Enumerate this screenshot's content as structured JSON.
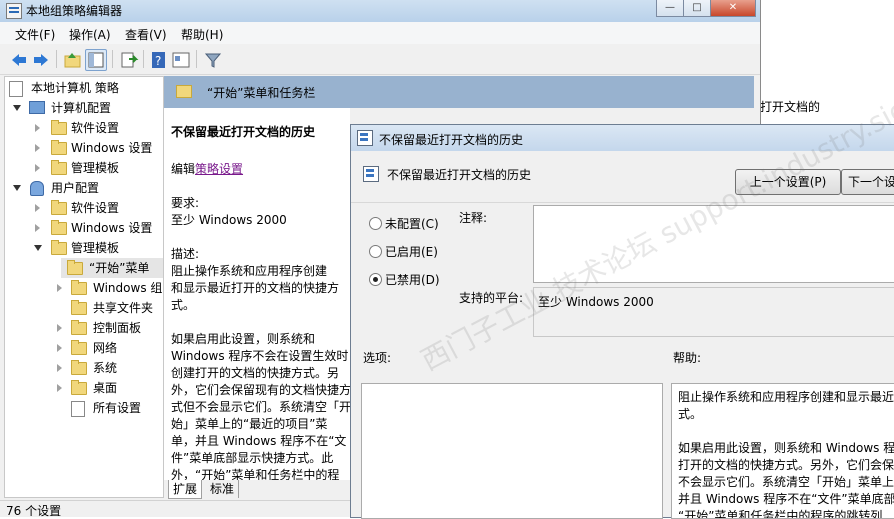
{
  "app": {
    "title": "本地组策略编辑器"
  },
  "caption_buttons": {
    "minimize": "—",
    "maximize": "□",
    "close": "✕"
  },
  "menu": [
    {
      "label": "文件(F)"
    },
    {
      "label": "操作(A)"
    },
    {
      "label": "查看(V)"
    },
    {
      "label": "帮助(H)"
    }
  ],
  "toolbar": {
    "icons": [
      "back-icon",
      "forward-icon",
      "up-folder-icon",
      "show-hide-tree-icon",
      "export-list-icon",
      "help-icon",
      "properties-icon",
      "filter-icon"
    ]
  },
  "tree": {
    "root": "本地计算机 策略",
    "computer_config": "计算机配置",
    "cc_software": "软件设置",
    "cc_windows": "Windows 设置",
    "cc_admin": "管理模板",
    "user_config": "用户配置",
    "uc_software": "软件设置",
    "uc_windows": "Windows 设置",
    "uc_admin": "管理模板",
    "start_menu": "“开始”菜单",
    "windows_components": "Windows 组",
    "shared_folders": "共享文件夹",
    "control_panel": "控制面板",
    "network": "网络",
    "system": "系统",
    "desktop": "桌面",
    "all_settings": "所有设置"
  },
  "right_pane": {
    "header_title": "“开始”菜单和任务栏",
    "policy_title": "不保留最近打开文档的历史",
    "edit_prefix": "编辑",
    "edit_link": "策略设置",
    "requirements_label": "要求:",
    "requirements_value": "至少 Windows 2000",
    "description_label": "描述:",
    "description_lines": [
      "阻止操作系统和应用程序创建",
      "和显示最近打开的文档的快捷方",
      "式。",
      "",
      "如果启用此设置，则系统和",
      "Windows 程序不会在设置生效时",
      "创建打开的文档的快捷方式。另",
      "外，它们会保留现有的文档快捷方",
      "式但不会显示它们。系统清空「开",
      "始」菜单上的“最近的项目”菜",
      "单，并且 Windows 程序不在“文",
      "件”菜单底部显示快捷方式。此",
      "外，“开始”菜单和任务栏中的程"
    ],
    "tab_extended": "扩展",
    "tab_standard": "标准"
  },
  "status": {
    "count_text": "76 个设置"
  },
  "background_window": {
    "text": "打开文档的"
  },
  "dialog": {
    "window_title": "不保留最近打开文档的历史",
    "setting_title": "不保留最近打开文档的历史",
    "prev_button": "上一个设置(P)",
    "next_button": "下一个设",
    "radio_not_configured": "未配置(C)",
    "radio_enabled": "已启用(E)",
    "radio_disabled": "已禁用(D)",
    "selected_option": "已禁用(D)",
    "comment_label": "注释:",
    "comment_value": "",
    "platform_label": "支持的平台:",
    "platform_value": "至少 Windows 2000",
    "options_label": "选项:",
    "help_label": "帮助:",
    "help_lines": [
      "阻止操作系统和应用程序创建和显示最近",
      "式。",
      "",
      "如果启用此设置，则系统和 Windows 程序",
      "打开的文档的快捷方式。另外，它们会保留",
      "不会显示它们。系统清空「开始」菜单上的",
      "并且 Windows 程序不在“文件”菜单底部",
      "“开始”菜单和任务栏中的程序的跳转列"
    ]
  },
  "watermark": {
    "text": "西门子工业 技术论坛  support.industry.siemens.com/cs"
  },
  "colors": {
    "header_band": "#98b2cf",
    "link": "#7a1a8c",
    "title_gradient": "#c4d7ec"
  }
}
